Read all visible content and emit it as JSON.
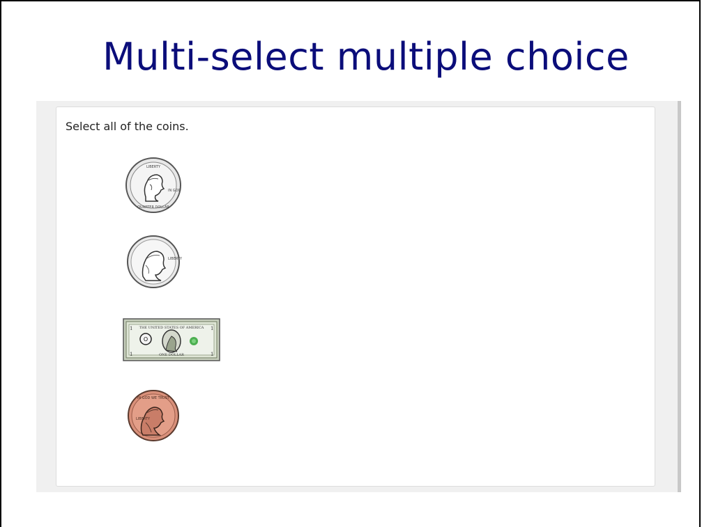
{
  "slide": {
    "title": "Multi-select multiple choice"
  },
  "question": {
    "prompt": "Select all of the coins.",
    "options": [
      {
        "id": "quarter",
        "icon": "quarter-coin-icon"
      },
      {
        "id": "nickel",
        "icon": "nickel-coin-icon"
      },
      {
        "id": "dollar",
        "icon": "dollar-bill-icon"
      },
      {
        "id": "penny",
        "icon": "penny-coin-icon"
      }
    ]
  },
  "colors": {
    "title": "#0b0d7a",
    "panel_bg": "#f0f0f0",
    "card_bg": "#ffffff",
    "silver_coin": "#e6e6e6",
    "penny": "#d9907a",
    "bill_green": "#a9b79a"
  }
}
